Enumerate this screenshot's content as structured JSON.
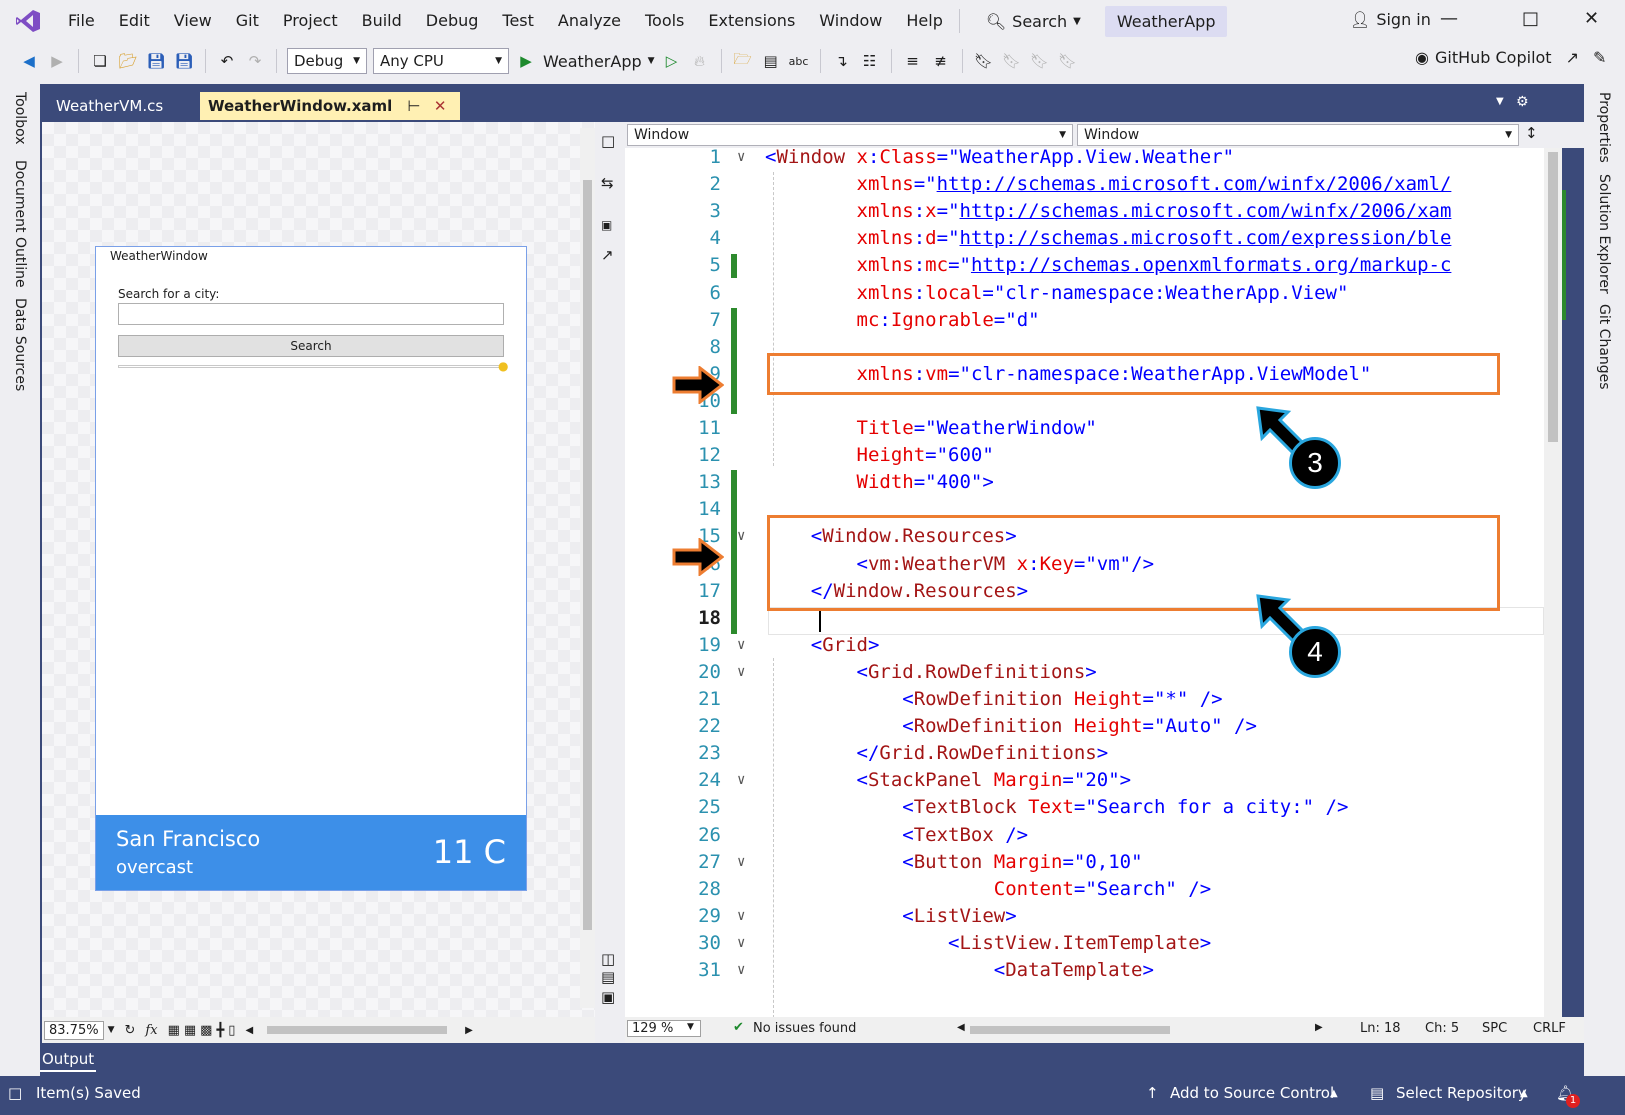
{
  "menubar": {
    "items": [
      "File",
      "Edit",
      "View",
      "Git",
      "Project",
      "Build",
      "Debug",
      "Test",
      "Analyze",
      "Tools",
      "Extensions",
      "Window",
      "Help"
    ],
    "search_label": "Search",
    "app_name": "WeatherApp",
    "sign_in": "Sign in"
  },
  "toolbar": {
    "config": "Debug",
    "platform": "Any CPU",
    "run_target": "WeatherApp",
    "copilot": "GitHub Copilot"
  },
  "side_panels": {
    "left": [
      "Toolbox",
      "Document Outline",
      "Data Sources"
    ],
    "right": [
      "Properties",
      "Solution Explorer",
      "Git Changes"
    ]
  },
  "tabs": [
    {
      "label": "WeatherVM.cs",
      "active": false
    },
    {
      "label": "WeatherWindow.xaml",
      "active": true
    }
  ],
  "designer": {
    "window_title": "WeatherWindow",
    "search_label": "Search for a city:",
    "search_button": "Search",
    "city": "San Francisco",
    "description": "overcast",
    "temperature": "11 C",
    "zoom": "83.75%"
  },
  "editor": {
    "nav_left": "Window",
    "nav_right": "Window",
    "zoom": "129 %",
    "issues": "No issues found",
    "line": "Ln: 18",
    "col": "Ch: 5",
    "spacing": "SPC",
    "eol": "CRLF",
    "current_line": 18,
    "lines": [
      [
        [
          "c-punct",
          "<"
        ],
        [
          "c-tag",
          "Window"
        ],
        [
          "",
          ""
        ],
        [
          "c-attr",
          " x"
        ],
        [
          "c-punct",
          ":"
        ],
        [
          "c-attr",
          "Class"
        ],
        [
          "c-punct",
          "="
        ],
        [
          "c-str",
          "\"WeatherApp.View.Weather\""
        ]
      ],
      [
        [
          "",
          ""
        ],
        [
          "c-attr",
          "        xmlns"
        ],
        [
          "c-punct",
          "=\""
        ],
        [
          "c-url",
          "http://schemas.microsoft.com/winfx/2006/xaml/"
        ]
      ],
      [
        [
          "c-attr",
          "        xmlns"
        ],
        [
          "c-punct",
          ":"
        ],
        [
          "c-attr",
          "x"
        ],
        [
          "c-punct",
          "=\""
        ],
        [
          "c-url",
          "http://schemas.microsoft.com/winfx/2006/xam"
        ]
      ],
      [
        [
          "c-attr",
          "        xmlns"
        ],
        [
          "c-punct",
          ":"
        ],
        [
          "c-attr",
          "d"
        ],
        [
          "c-punct",
          "=\""
        ],
        [
          "c-url",
          "http://schemas.microsoft.com/expression/ble"
        ]
      ],
      [
        [
          "c-attr",
          "        xmlns"
        ],
        [
          "c-punct",
          ":"
        ],
        [
          "c-attr",
          "mc"
        ],
        [
          "c-punct",
          "=\""
        ],
        [
          "c-url",
          "http://schemas.openxmlformats.org/markup-c"
        ]
      ],
      [
        [
          "c-attr",
          "        xmlns"
        ],
        [
          "c-punct",
          ":"
        ],
        [
          "c-attr",
          "local"
        ],
        [
          "c-punct",
          "="
        ],
        [
          "c-str",
          "\"clr-namespace:WeatherApp.View\""
        ]
      ],
      [
        [
          "c-attr",
          "        mc"
        ],
        [
          "c-punct",
          ":"
        ],
        [
          "c-attr",
          "Ignorable"
        ],
        [
          "c-punct",
          "="
        ],
        [
          "c-str",
          "\"d\""
        ]
      ],
      [
        [
          "",
          ""
        ]
      ],
      [
        [
          "c-attr",
          "        xmlns"
        ],
        [
          "c-punct",
          ":"
        ],
        [
          "c-attr",
          "vm"
        ],
        [
          "c-punct",
          "="
        ],
        [
          "c-str",
          "\"clr-namespace:WeatherApp.ViewModel\""
        ]
      ],
      [
        [
          "",
          ""
        ]
      ],
      [
        [
          "c-attr",
          "        Title"
        ],
        [
          "c-punct",
          "="
        ],
        [
          "c-str",
          "\"WeatherWindow\""
        ]
      ],
      [
        [
          "c-attr",
          "        Height"
        ],
        [
          "c-punct",
          "="
        ],
        [
          "c-str",
          "\"600\""
        ]
      ],
      [
        [
          "c-attr",
          "        Width"
        ],
        [
          "c-punct",
          "="
        ],
        [
          "c-str",
          "\"400\""
        ],
        [
          "c-punct",
          ">"
        ]
      ],
      [
        [
          "",
          ""
        ]
      ],
      [
        [
          "c-punct",
          "    <"
        ],
        [
          "c-tag",
          "Window.Resources"
        ],
        [
          "c-punct",
          ">"
        ]
      ],
      [
        [
          "c-punct",
          "        <"
        ],
        [
          "c-tag",
          "vm:WeatherVM"
        ],
        [
          "c-attr",
          " x"
        ],
        [
          "c-punct",
          ":"
        ],
        [
          "c-attr",
          "Key"
        ],
        [
          "c-punct",
          "="
        ],
        [
          "c-str",
          "\"vm\""
        ],
        [
          "c-punct",
          "/>"
        ]
      ],
      [
        [
          "c-punct",
          "    </"
        ],
        [
          "c-tag",
          "Window.Resources"
        ],
        [
          "c-punct",
          ">"
        ]
      ],
      [
        [
          "",
          ""
        ]
      ],
      [
        [
          "c-punct",
          "    <"
        ],
        [
          "c-tag",
          "Grid"
        ],
        [
          "c-punct",
          ">"
        ]
      ],
      [
        [
          "c-punct",
          "        <"
        ],
        [
          "c-tag",
          "Grid.RowDefinitions"
        ],
        [
          "c-punct",
          ">"
        ]
      ],
      [
        [
          "c-punct",
          "            <"
        ],
        [
          "c-tag",
          "RowDefinition"
        ],
        [
          "c-attr",
          " Height"
        ],
        [
          "c-punct",
          "="
        ],
        [
          "c-str",
          "\"*\""
        ],
        [
          "c-punct",
          " />"
        ]
      ],
      [
        [
          "c-punct",
          "            <"
        ],
        [
          "c-tag",
          "RowDefinition"
        ],
        [
          "c-attr",
          " Height"
        ],
        [
          "c-punct",
          "="
        ],
        [
          "c-str",
          "\"Auto\""
        ],
        [
          "c-punct",
          " />"
        ]
      ],
      [
        [
          "c-punct",
          "        </"
        ],
        [
          "c-tag",
          "Grid.RowDefinitions"
        ],
        [
          "c-punct",
          ">"
        ]
      ],
      [
        [
          "c-punct",
          "        <"
        ],
        [
          "c-tag",
          "StackPanel"
        ],
        [
          "c-attr",
          " Margin"
        ],
        [
          "c-punct",
          "="
        ],
        [
          "c-str",
          "\"20\""
        ],
        [
          "c-punct",
          ">"
        ]
      ],
      [
        [
          "c-punct",
          "            <"
        ],
        [
          "c-tag",
          "TextBlock"
        ],
        [
          "c-attr",
          " Text"
        ],
        [
          "c-punct",
          "="
        ],
        [
          "c-str",
          "\"Search for a city:\""
        ],
        [
          "c-punct",
          " />"
        ]
      ],
      [
        [
          "c-punct",
          "            <"
        ],
        [
          "c-tag",
          "TextBox"
        ],
        [
          "c-punct",
          " />"
        ]
      ],
      [
        [
          "c-punct",
          "            <"
        ],
        [
          "c-tag",
          "Button"
        ],
        [
          "c-attr",
          " Margin"
        ],
        [
          "c-punct",
          "="
        ],
        [
          "c-str",
          "\"0,10\""
        ]
      ],
      [
        [
          "c-attr",
          "                    Content"
        ],
        [
          "c-punct",
          "="
        ],
        [
          "c-str",
          "\"Search\""
        ],
        [
          "c-punct",
          " />"
        ]
      ],
      [
        [
          "c-punct",
          "            <"
        ],
        [
          "c-tag",
          "ListView"
        ],
        [
          "c-punct",
          ">"
        ]
      ],
      [
        [
          "c-punct",
          "                <"
        ],
        [
          "c-tag",
          "ListView.ItemTemplate"
        ],
        [
          "c-punct",
          ">"
        ]
      ],
      [
        [
          "c-punct",
          "                    <"
        ],
        [
          "c-tag",
          "DataTemplate"
        ],
        [
          "c-punct",
          ">"
        ]
      ]
    ]
  },
  "callouts": [
    "3",
    "4"
  ],
  "output_tab": "Output",
  "statusbar": {
    "left": "Item(s) Saved",
    "source_control": "Add to Source Control",
    "repository": "Select Repository",
    "notifications": "1"
  },
  "colors": {
    "accent": "#3b4a7a",
    "highlight": "#ed7d31",
    "badge_ring": "#29a6de",
    "footer": "#3d8fe8"
  }
}
